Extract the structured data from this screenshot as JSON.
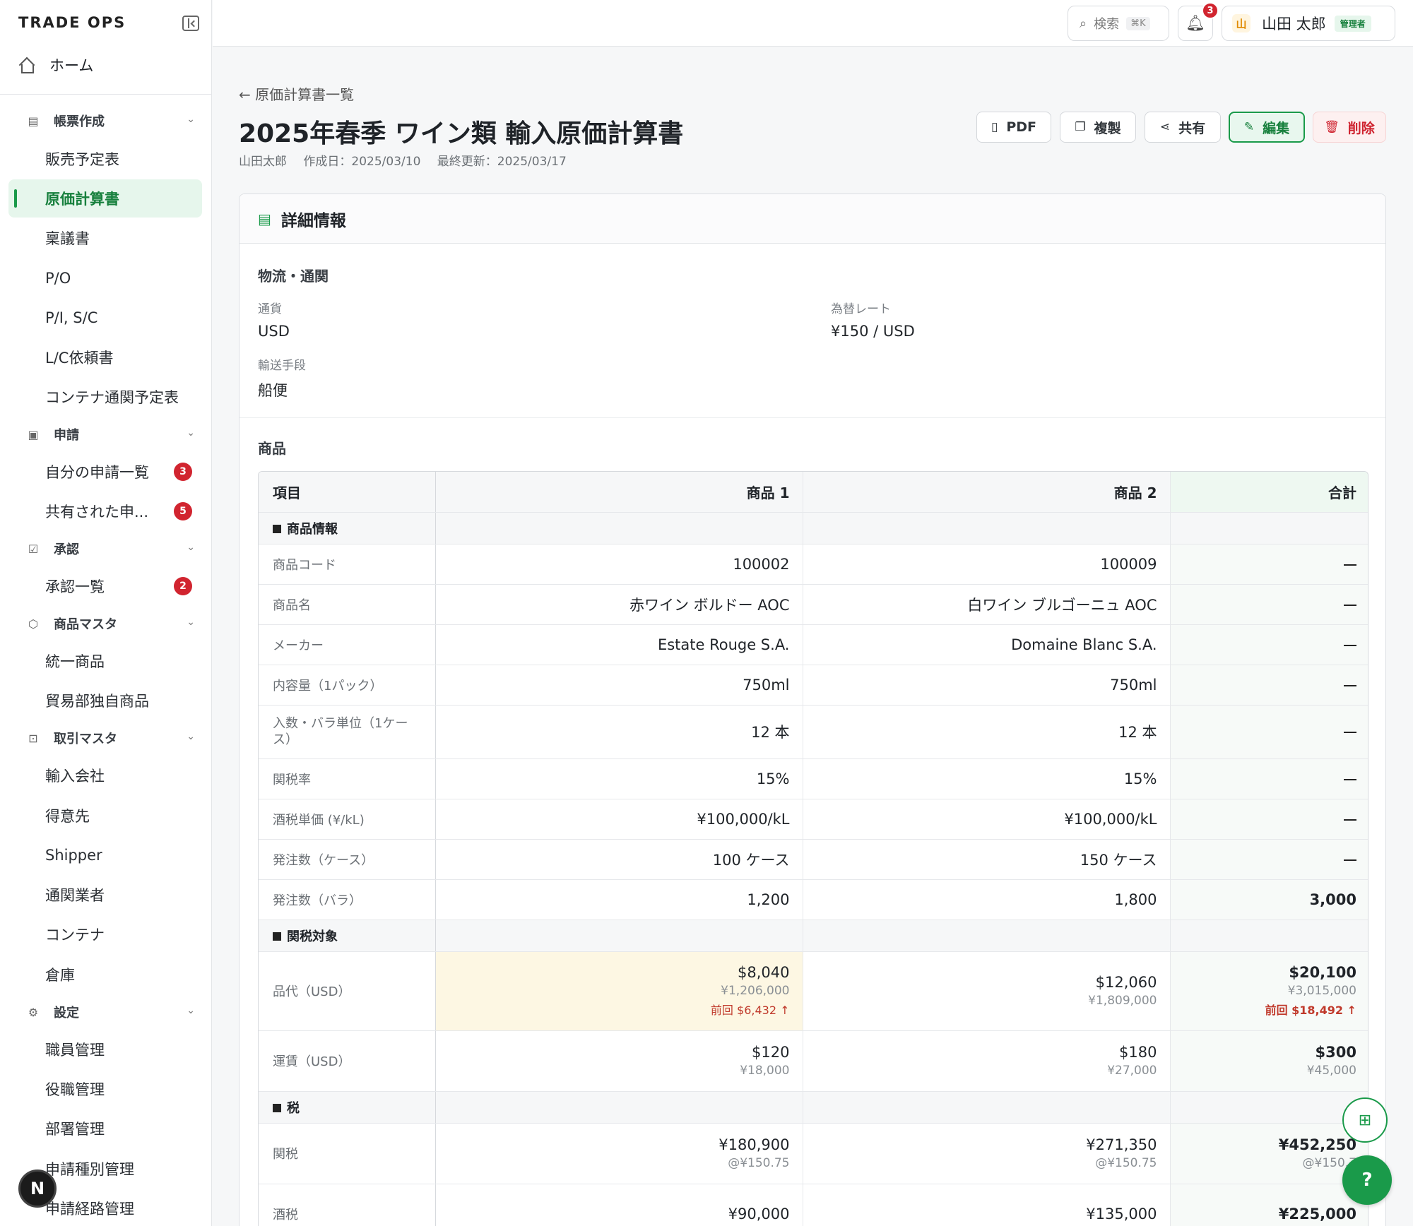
{
  "app": {
    "brand": "TRADE OPS"
  },
  "sidebar": {
    "home_label": "ホーム",
    "sections": [
      {
        "label": "帳票作成",
        "icon": "document-icon"
      },
      {
        "label": "申請",
        "icon": "clipboard-icon"
      },
      {
        "label": "承認",
        "icon": "check-square-icon"
      },
      {
        "label": "商品マスタ",
        "icon": "package-icon"
      },
      {
        "label": "取引マスタ",
        "icon": "briefcase-icon"
      },
      {
        "label": "設定",
        "icon": "gear-icon"
      }
    ],
    "items": [
      {
        "label": "販売予定表"
      },
      {
        "label": "原価計算書",
        "active": true
      },
      {
        "label": "稟議書"
      },
      {
        "label": "P/O"
      },
      {
        "label": "P/I, S/C"
      },
      {
        "label": "L/C依頼書"
      },
      {
        "label": "コンテナ通関予定表"
      },
      {
        "label": "自分の申請一覧",
        "badge": "3"
      },
      {
        "label": "共有された申...",
        "badge": "5"
      },
      {
        "label": "承認一覧",
        "badge": "2"
      },
      {
        "label": "統一商品"
      },
      {
        "label": "貿易部独自商品"
      },
      {
        "label": "輸入会社"
      },
      {
        "label": "得意先"
      },
      {
        "label": "Shipper"
      },
      {
        "label": "通関業者"
      },
      {
        "label": "コンテナ"
      },
      {
        "label": "倉庫"
      },
      {
        "label": "職員管理"
      },
      {
        "label": "役職管理"
      },
      {
        "label": "部署管理"
      },
      {
        "label": "申請種別管理"
      },
      {
        "label": "申請経路管理"
      }
    ],
    "bottom_button": "N"
  },
  "topbar": {
    "search_label": "検索",
    "search_shortcut": "⌘K",
    "notification_count": "3",
    "user_initial": "山",
    "user_name": "山田 太郎",
    "user_role": "管理者"
  },
  "page": {
    "back_label": "原価計算書一覧",
    "title": "2025年春季 ワイン類 輸入原価計算書",
    "author": "山田太郎",
    "created": "作成日：2025/03/10",
    "updated": "最終更新：2025/03/17",
    "actions": {
      "pdf": "PDF",
      "duplicate": "複製",
      "share": "共有",
      "edit": "編集",
      "delete": "削除"
    }
  },
  "detail": {
    "title": "詳細情報",
    "logistics": {
      "title": "物流・通関",
      "currency_label": "通貨",
      "currency_value": "USD",
      "rate_label": "為替レート",
      "rate_value": "¥150 / USD",
      "transport_label": "輸送手段",
      "transport_value": "船便"
    },
    "products_title": "商品",
    "table": {
      "headers": [
        "項目",
        "商品 1",
        "商品 2",
        "合計"
      ],
      "cat_info": "商品情報",
      "rows_info": [
        {
          "label": "商品コード",
          "p1": "100002",
          "p2": "100009"
        },
        {
          "label": "商品名",
          "p1": "赤ワイン ボルドー AOC",
          "p2": "白ワイン ブルゴーニュ AOC"
        },
        {
          "label": "メーカー",
          "p1": "Estate Rouge S.A.",
          "p2": "Domaine Blanc S.A."
        },
        {
          "label": "内容量（1パック）",
          "p1": "750ml",
          "p2": "750ml"
        },
        {
          "label": "入数・バラ単位（1ケース）",
          "p1": "12 本",
          "p2": "12 本"
        },
        {
          "label": "関税率",
          "p1": "15%",
          "p2": "15%"
        },
        {
          "label": "酒税単価 (¥/kL)",
          "p1": "¥100,000/kL",
          "p2": "¥100,000/kL"
        },
        {
          "label": "発注数（ケース）",
          "p1": "100 ケース",
          "p2": "150 ケース"
        },
        {
          "label": "発注数（バラ）",
          "p1": "1,200",
          "p2": "1,800",
          "total": "3,000"
        }
      ],
      "cat_tariff": "関税対象",
      "goods": {
        "label": "品代（USD）",
        "p1": "$8,040",
        "p1_yen": "¥1,206,000",
        "p1_prev": "前回 $6,432 ↑",
        "p2": "$12,060",
        "p2_yen": "¥1,809,000",
        "total": "$20,100",
        "total_yen": "¥3,015,000",
        "total_prev": "前回 $18,492 ↑"
      },
      "freight": {
        "label": "運賃（USD）",
        "p1": "$120",
        "p1_yen": "¥18,000",
        "p2": "$180",
        "p2_yen": "¥27,000",
        "total": "$300",
        "total_yen": "¥45,000"
      },
      "cat_tax": "税",
      "duty": {
        "label": "関税",
        "p1": "¥180,900",
        "p1_rate": "@¥150.75",
        "p2": "¥271,350",
        "p2_rate": "@¥150.75",
        "total": "¥452,250",
        "total_rate": "@¥150.7"
      },
      "liquor": {
        "label": "酒税",
        "p1": "¥90,000",
        "p2": "¥135,000",
        "total": "¥225,000"
      }
    }
  },
  "colors": {
    "accent": "#1a9a4a",
    "danger": "#cf222e",
    "highlight": "#fdf7e3"
  }
}
